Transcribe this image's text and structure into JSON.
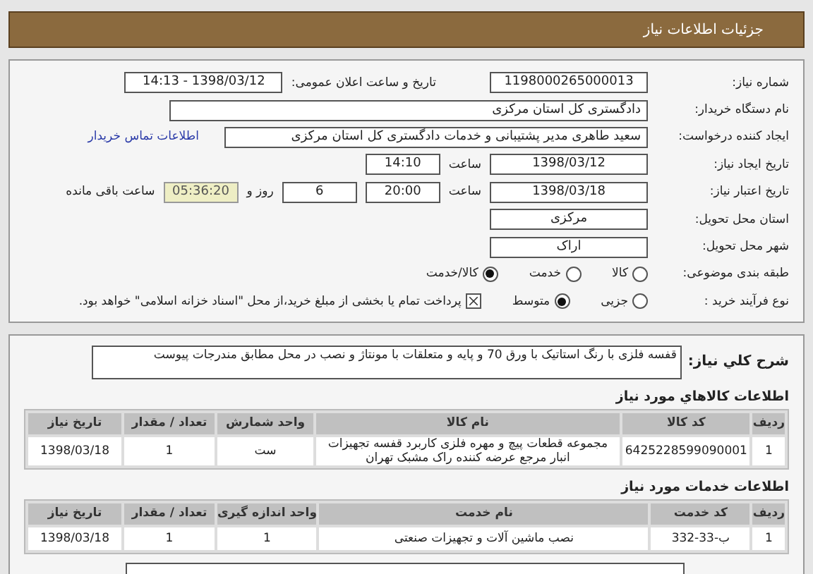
{
  "header": {
    "title": "جزئیات اطلاعات نیاز"
  },
  "form": [
    {
      "label": "شماره نیاز:",
      "items": [
        {
          "kind": "field",
          "value": "1198000265000013"
        },
        {
          "kind": "text",
          "value": "تاریخ و ساعت اعلان عمومی:"
        },
        {
          "kind": "field",
          "value": "1398/03/12 - 14:13"
        }
      ]
    },
    {
      "label": "نام دستگاه خریدار:",
      "items": [
        {
          "kind": "long-field",
          "value": "دادگستری کل استان مرکزی"
        }
      ]
    },
    {
      "label": "ایجاد کننده درخواست:",
      "items": [
        {
          "kind": "long-field",
          "value": "سعید طاهری مدیر پشتیبانی و خدمات دادگستری کل استان مرکزی"
        },
        {
          "kind": "link",
          "value": "اطلاعات تماس خریدار"
        }
      ]
    },
    {
      "label": "تاریخ ایجاد نیاز:",
      "items": [
        {
          "kind": "field",
          "value": "1398/03/12"
        },
        {
          "kind": "text",
          "value": "ساعت"
        },
        {
          "kind": "short-field",
          "value": "14:10"
        }
      ]
    },
    {
      "label": "تاریخ اعتبار نیاز:",
      "items": [
        {
          "kind": "field",
          "value": "1398/03/18"
        },
        {
          "kind": "text",
          "value": "ساعت"
        },
        {
          "kind": "short-field",
          "value": "20:00"
        },
        {
          "kind": "short-field",
          "value": "6"
        },
        {
          "kind": "text",
          "value": "روز و"
        },
        {
          "kind": "timer",
          "value": "05:36:20"
        },
        {
          "kind": "text",
          "value": "ساعت باقی مانده"
        }
      ]
    },
    {
      "label": "استان محل تحویل:",
      "items": [
        {
          "kind": "field",
          "value": "مرکزی"
        }
      ]
    },
    {
      "label": "شهر محل تحویل:",
      "items": [
        {
          "kind": "field",
          "value": "اراک"
        }
      ]
    },
    {
      "label": "طبقه بندی موضوعی:",
      "items": [
        {
          "kind": "radio",
          "value": "کالا",
          "selected": false
        },
        {
          "kind": "radio",
          "value": "خدمت",
          "selected": false
        },
        {
          "kind": "radio",
          "value": "کالا/خدمت",
          "selected": true
        }
      ]
    },
    {
      "label": "نوع فرآیند خرید :",
      "items": [
        {
          "kind": "radio",
          "value": "جزیی",
          "selected": false
        },
        {
          "kind": "radio",
          "value": "متوسط",
          "selected": true
        },
        {
          "kind": "checkbox",
          "value": "پرداخت تمام یا بخشی از مبلغ خرید،از محل \"اسناد خزانه اسلامی\" خواهد بود.",
          "checked": true
        }
      ]
    }
  ],
  "description": {
    "label": "شرح کلي نياز:",
    "value": "قفسه فلزی با رنگ استاتیک با ورق 70 و پایه و متعلقات با مونتاژ و نصب در محل مطابق مندرجات پیوست"
  },
  "goods": {
    "title": "اطلاعات کالاهاي مورد نياز",
    "columns": [
      "ردیف",
      "کد کالا",
      "نام کالا",
      "واحد شمارش",
      "تعداد / مقدار",
      "تاریخ نیاز"
    ],
    "rows": [
      [
        "1",
        "6425228599090001",
        "مجموعه قطعات پیچ و مهره فلزی کاربرد قفسه تجهیزات انبار مرجع عرضه کننده راک مشبک تهران",
        "ست",
        "1",
        "1398/03/18"
      ]
    ]
  },
  "services": {
    "title": "اطلاعات خدمات مورد نياز",
    "columns": [
      "ردیف",
      "کد خدمت",
      "نام خدمت",
      "واحد اندازه گیری",
      "تعداد / مقدار",
      "تاریخ نیاز"
    ],
    "rows": [
      [
        "1",
        "ب-33-332",
        "نصب ماشین آلات و تجهیزات صنعتی",
        "1",
        "1",
        "1398/03/18"
      ]
    ]
  }
}
